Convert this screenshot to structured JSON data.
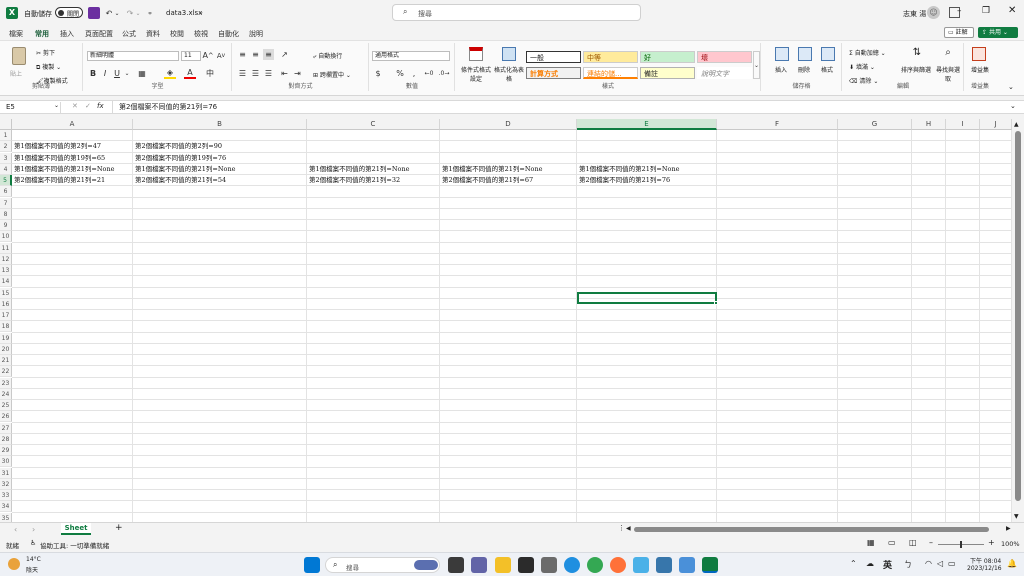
{
  "titlebar": {
    "autosave_label": "自動儲存",
    "autosave_state": "關閉",
    "filename": "data3.xlsx",
    "search_placeholder": "搜尋",
    "user_name": "志東 湯",
    "brand_color": "#107c41"
  },
  "menu": {
    "tabs": [
      "檔案",
      "常用",
      "插入",
      "頁面配置",
      "公式",
      "資料",
      "校閱",
      "檢視",
      "自動化",
      "說明"
    ],
    "active": "常用",
    "comments_label": "註解",
    "share_label": "共用"
  },
  "ribbon": {
    "clipboard": {
      "paste": "貼上",
      "cut": "剪下",
      "copy": "複製",
      "format_painter": "複製格式",
      "label": "剪貼簿"
    },
    "font": {
      "name": "新細明體",
      "size": "11",
      "bold": "B",
      "italic": "I",
      "underline": "U",
      "label": "字型"
    },
    "alignment": {
      "wrap": "自動換行",
      "merge": "跨欄置中",
      "label": "對齊方式"
    },
    "number": {
      "format": "通用格式",
      "label": "數值"
    },
    "styles": {
      "conditional": "條件式格式設定",
      "as_table": "格式化為表格",
      "normal": "一般",
      "neutral": "中等",
      "good": "好",
      "bad": "壞",
      "calculation": "計算方式",
      "linked": "連結的儲...",
      "note": "備註",
      "explanatory": "說明文字",
      "label": "樣式"
    },
    "cells": {
      "insert": "插入",
      "delete": "刪除",
      "format": "格式",
      "label": "儲存格"
    },
    "editing": {
      "autosum": "自動加總",
      "fill": "填滿",
      "clear": "清除",
      "sort": "排序與篩選",
      "find": "尋找與選取",
      "label": "編輯"
    },
    "addins": {
      "btn": "增益集",
      "label": "增益集"
    }
  },
  "formula": {
    "namebox": "E5",
    "content": "第2個檔案不同值的第21列=76"
  },
  "grid": {
    "columns": [
      "A",
      "B",
      "C",
      "D",
      "E",
      "F",
      "G",
      "H",
      "I",
      "J"
    ],
    "rows": [
      "1",
      "2",
      "3",
      "4",
      "5",
      "6",
      "7",
      "8",
      "9",
      "10",
      "11",
      "12",
      "13",
      "14",
      "15",
      "16",
      "17",
      "18",
      "19",
      "20",
      "21",
      "22",
      "23",
      "24",
      "25",
      "26",
      "27",
      "28",
      "29",
      "30",
      "31",
      "32",
      "33",
      "34",
      "35"
    ],
    "cells": {
      "A2": "第1個檔案不同值的第2列=47",
      "B2": "第2個檔案不同值的第2列=90",
      "A3": "第1個檔案不同值的第19列=65",
      "B3": "第2個檔案不同值的第19列=76",
      "A4": "第1個檔案不同值的第21列=None",
      "B4": "第1個檔案不同值的第21列=None",
      "C4": "第1個檔案不同值的第21列=None",
      "D4": "第1個檔案不同值的第21列=None",
      "E4": "第1個檔案不同值的第21列=None",
      "A5": "第2個檔案不同值的第21列=21",
      "B5": "第2個檔案不同值的第21列=54",
      "C5": "第2個檔案不同值的第21列=32",
      "D5": "第2個檔案不同值的第21列=67",
      "E5": "第2個檔案不同值的第21列=76"
    }
  },
  "sheets": {
    "tabs": [
      "Sheet"
    ],
    "add": "+"
  },
  "status": {
    "ready": "就緒",
    "accessibility": "協助工具: 一切準備就緒",
    "zoom": "100%"
  },
  "taskbar": {
    "weather_temp": "14°C",
    "weather_desc": "陰天",
    "search_placeholder": "搜尋",
    "ime": "英",
    "time": "下午 08:04",
    "date": "2023/12/16"
  }
}
